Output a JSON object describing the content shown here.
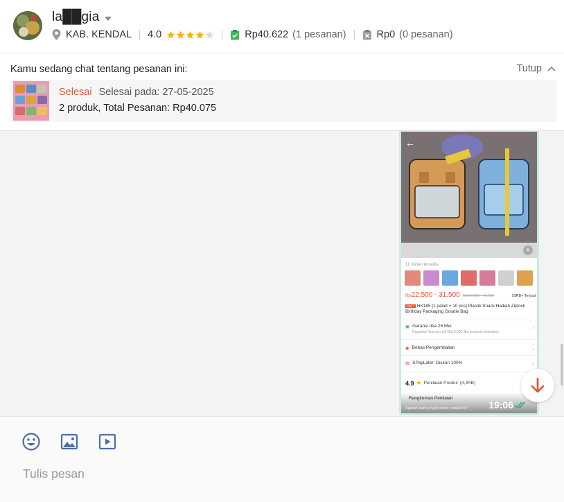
{
  "header": {
    "username": "la██gia",
    "location": "KAB. KENDAL",
    "rating": "4.0",
    "stars_filled": 4,
    "stars_total": 5,
    "paid_amount": "Rp40.622",
    "paid_orders": "(1 pesanan)",
    "cancelled_amount": "Rp0",
    "cancelled_orders": "(0 pesanan)"
  },
  "order_panel": {
    "title": "Kamu sedang chat tentang pesanan ini:",
    "collapse_label": "Tutup",
    "status": "Selesai",
    "status_date": "Selesai pada: 27-05-2025",
    "summary": "2 produk, Total Pesanan: Rp40.075"
  },
  "message": {
    "time": "19:06",
    "screenshot": {
      "variants_label": "11 Varian tersedia",
      "price_prefix": "Rp",
      "price": "22.500 - 31.500",
      "price_original": "Rp60.000 - 45.000",
      "sold": "10RB+ Terjual",
      "tag": "Star+",
      "title": "HX185 [1 paket = 10 pcs] Plastik Snack Hadiah Ziplock Birthday Packaging Goodie Bag",
      "shipping": "Garansi tiba 26 Mei",
      "shipping_sub": "Dapatkan Voucher s/d Rp10.000 jika pesanan terlambat.",
      "returns": "Bebas Pengembalian",
      "paylater": "SPayLater: Diskon 100%",
      "product_rating": "4.9",
      "rating_label": "Penilaian Produk",
      "rating_count": "(4,3RB)",
      "ranking_label": "Rangkuman Penilaian",
      "share_prompt": "Apakah kamu ingin share produk ini?"
    }
  },
  "composer": {
    "placeholder": "Tulis pesan"
  },
  "colors": {
    "accent": "#ee4d2d",
    "status_done": "#e05a3a",
    "star": "#f6b400",
    "bubble": "#c9ecdf"
  }
}
